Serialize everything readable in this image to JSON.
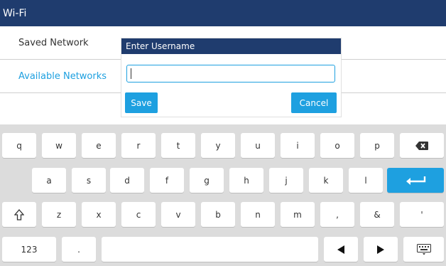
{
  "window": {
    "title": "Wi-Fi"
  },
  "list": {
    "items": [
      {
        "label": "Saved Network"
      },
      {
        "label": "Available Networks"
      }
    ]
  },
  "dialog": {
    "title": "Enter Username",
    "input_value": "",
    "save_label": "Save",
    "cancel_label": "Cancel"
  },
  "keyboard": {
    "row1": [
      "q",
      "w",
      "e",
      "r",
      "t",
      "y",
      "u",
      "i",
      "o",
      "p"
    ],
    "row2": [
      "a",
      "s",
      "d",
      "f",
      "g",
      "h",
      "j",
      "k",
      "l"
    ],
    "row3": [
      "z",
      "x",
      "c",
      "v",
      "b",
      "n",
      "m",
      ",",
      "&",
      "'"
    ],
    "numbers_label": "123",
    "period_label": ".",
    "icons": {
      "backspace": "backspace-icon",
      "enter": "enter-icon",
      "shift": "shift-icon",
      "left": "arrow-left-icon",
      "right": "arrow-right-icon",
      "hide": "keyboard-icon"
    },
    "accent_color": "#1ea0e0"
  },
  "colors": {
    "header": "#1f3c6e",
    "accent": "#1ea0e0",
    "keyboard_bg": "#dcdcdc"
  }
}
